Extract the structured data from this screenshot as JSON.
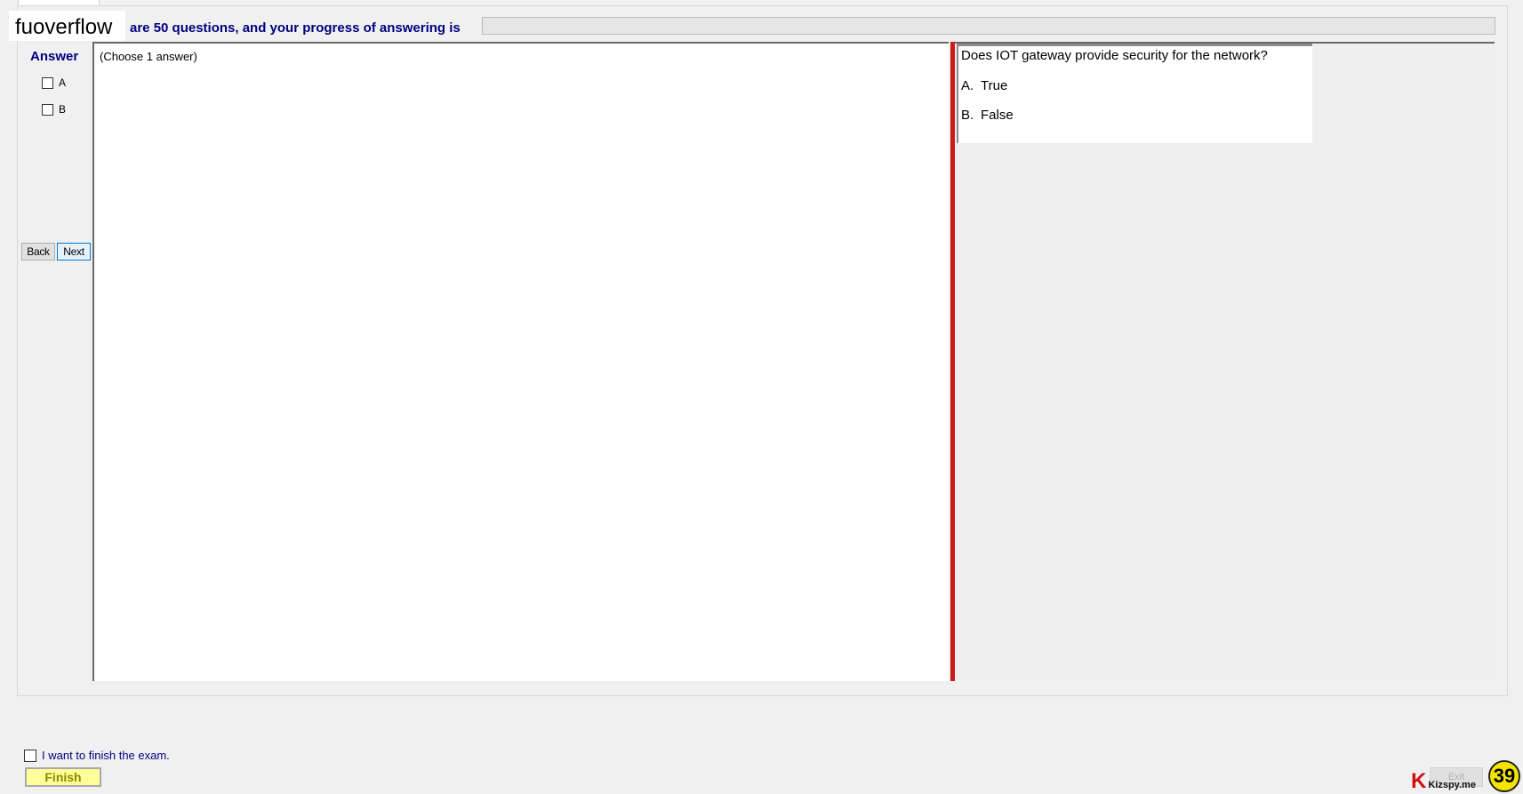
{
  "watermark": "fuoverflow",
  "header": {
    "progress_text": "are 50 questions, and your progress of answering is",
    "progress_fraction": 0
  },
  "answer_panel": {
    "title": "Answer",
    "options": [
      "A",
      "B"
    ]
  },
  "nav": {
    "back_label": "Back",
    "next_label": "Next"
  },
  "content": {
    "instruction": "(Choose 1 answer)"
  },
  "question": {
    "text": "Does IOT gateway provide security for the network?",
    "options": [
      {
        "letter": "A.",
        "text": "True"
      },
      {
        "letter": "B.",
        "text": "False"
      }
    ]
  },
  "footer": {
    "finish_checkbox_label": "I want to finish the exam.",
    "finish_label": "Finish",
    "exit_label": "Exit",
    "brand_letter": "K",
    "brand_text": "Kizspy.me",
    "badge_number": "39"
  },
  "colors": {
    "accent_navy": "#000080",
    "splitter_red": "#cf1a1a",
    "finish_yellow": "#ffff99",
    "badge_yellow": "#f5e400"
  }
}
